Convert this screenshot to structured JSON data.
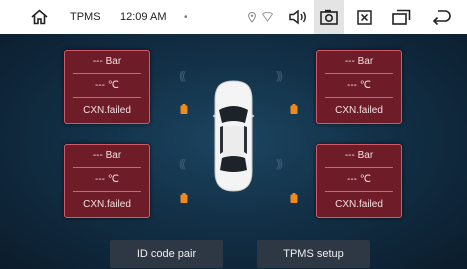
{
  "status_bar": {
    "title": "TPMS",
    "time": "12:09 AM",
    "dot": "•"
  },
  "tires": [
    {
      "pressure": "--- Bar",
      "temperature": "--- ℃",
      "status": "CXN.failed"
    },
    {
      "pressure": "--- Bar",
      "temperature": "--- ℃",
      "status": "CXN.failed"
    },
    {
      "pressure": "--- Bar",
      "temperature": "--- ℃",
      "status": "CXN.failed"
    },
    {
      "pressure": "--- Bar",
      "temperature": "--- ℃",
      "status": "CXN.failed"
    }
  ],
  "buttons": {
    "id_code_pair": "ID code pair",
    "tpms_setup": "TPMS setup"
  },
  "icons": {
    "home": "home-icon",
    "location": "location-icon",
    "wifi": "wifi-icon",
    "volume": "volume-icon",
    "screenshot": "screenshot-icon",
    "close": "close-icon",
    "window": "window-icon",
    "back": "back-icon",
    "battery": "battery-icon",
    "signal": "signal-icon",
    "car": "car-icon"
  },
  "colors": {
    "panel": "#6e1c28",
    "panel_border": "#d05a68",
    "battery": "#f08a1c",
    "background": "#123047"
  }
}
